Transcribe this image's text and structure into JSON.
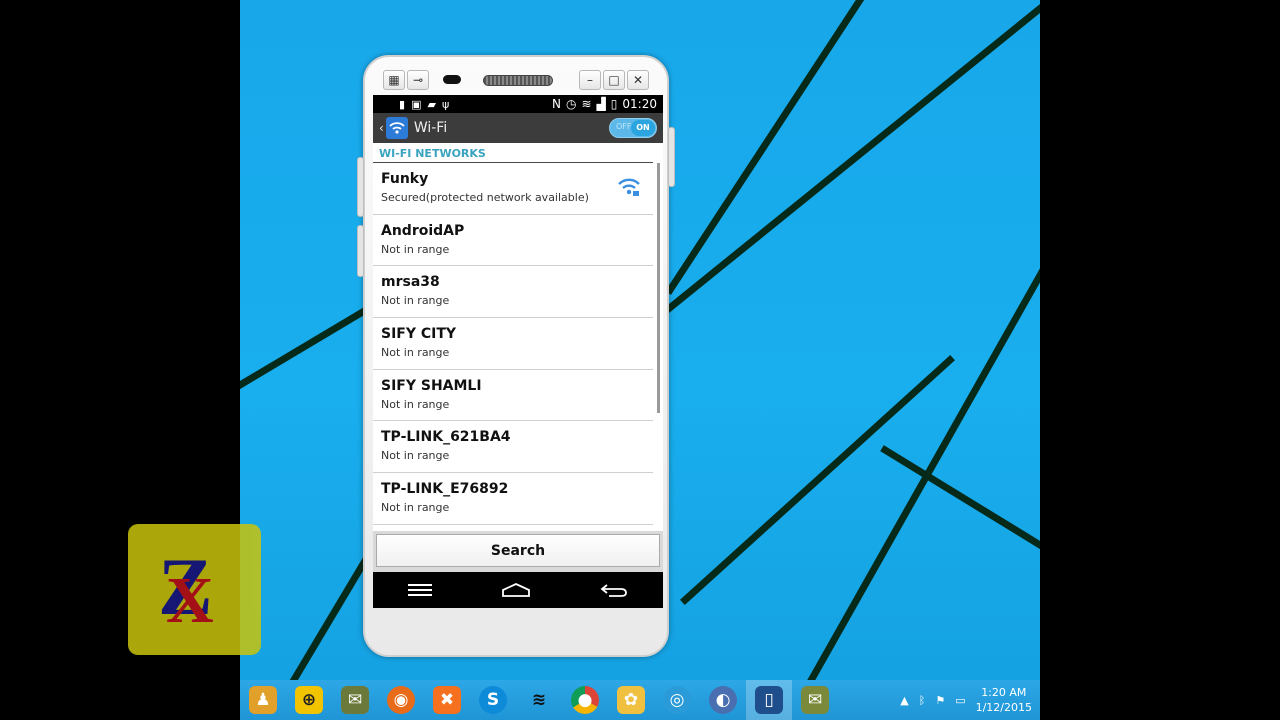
{
  "emulator": {
    "toolbar_icons": [
      "grid-icon",
      "plug-icon"
    ],
    "window_controls": [
      "minimize-icon",
      "maximize-icon",
      "close-icon"
    ]
  },
  "statusbar": {
    "left_icons": [
      "battery-alert-icon",
      "screenshot-icon",
      "message-icon",
      "usb-icon"
    ],
    "right_icons": [
      "nfc-icon",
      "alarm-icon",
      "wifi-icon",
      "signal-icon",
      "battery-icon"
    ],
    "time": "01:20"
  },
  "actionbar": {
    "title": "Wi-Fi",
    "toggle_off": "OFF",
    "toggle_on": "ON"
  },
  "section_header": "WI-FI NETWORKS",
  "networks": [
    {
      "name": "Funky",
      "status": "Secured(protected network available)",
      "signal": true
    },
    {
      "name": "AndroidAP",
      "status": "Not in range"
    },
    {
      "name": "mrsa38",
      "status": "Not in range"
    },
    {
      "name": "SIFY CITY",
      "status": "Not in range"
    },
    {
      "name": "SIFY SHAMLI",
      "status": "Not in range"
    },
    {
      "name": "TP-LINK_621BA4",
      "status": "Not in range"
    },
    {
      "name": "TP-LINK_E76892",
      "status": "Not in range"
    }
  ],
  "search_label": "Search",
  "navbar": [
    "menu-icon",
    "home-icon",
    "back-icon"
  ],
  "taskbar": {
    "apps": [
      "user-icon",
      "globe-icon",
      "mail-icon",
      "firefox-icon",
      "xampp-icon",
      "skype-icon",
      "wifi-icon",
      "chrome-icon",
      "paint-icon",
      "hotspot-icon",
      "torrent-icon",
      "emulator-icon",
      "mail-alert-icon"
    ],
    "active_index": 11,
    "time": "1:20 AM",
    "date": "1/12/2015"
  },
  "colors": {
    "desktop": "#19aeee",
    "accent": "#3aa3c0",
    "taskbar": "#2da7e6"
  }
}
